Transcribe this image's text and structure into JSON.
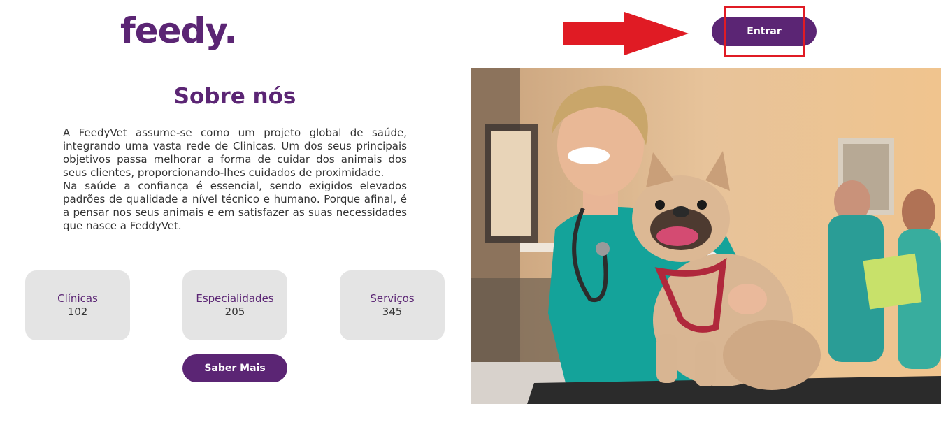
{
  "header": {
    "logo_text": "feedy.",
    "enter_label": "Entrar"
  },
  "main": {
    "title": "Sobre nós",
    "paragraph_1": "A FeedyVet assume-se como um projeto global de saúde, integrando uma vasta rede de Clinicas. Um dos seus principais objetivos passa melhorar a forma de cuidar dos animais dos seus clientes, proporcionando-lhes cuidados de proximidade.",
    "paragraph_2": "Na saúde a confiança é essencial, sendo exigidos elevados padrões de qualidade a nível técnico e humano. Porque afinal, é a pensar nos seus animais e em satisfazer as suas necessidades que nasce a FeddyVet.",
    "stats": [
      {
        "label": "Clínicas",
        "value": "102"
      },
      {
        "label": "Especialidades",
        "value": "205"
      },
      {
        "label": "Serviços",
        "value": "345"
      }
    ],
    "more_label": "Saber Mais"
  },
  "colors": {
    "brand": "#5b2574",
    "highlight": "#e01b24",
    "card_bg": "#e4e4e4"
  }
}
